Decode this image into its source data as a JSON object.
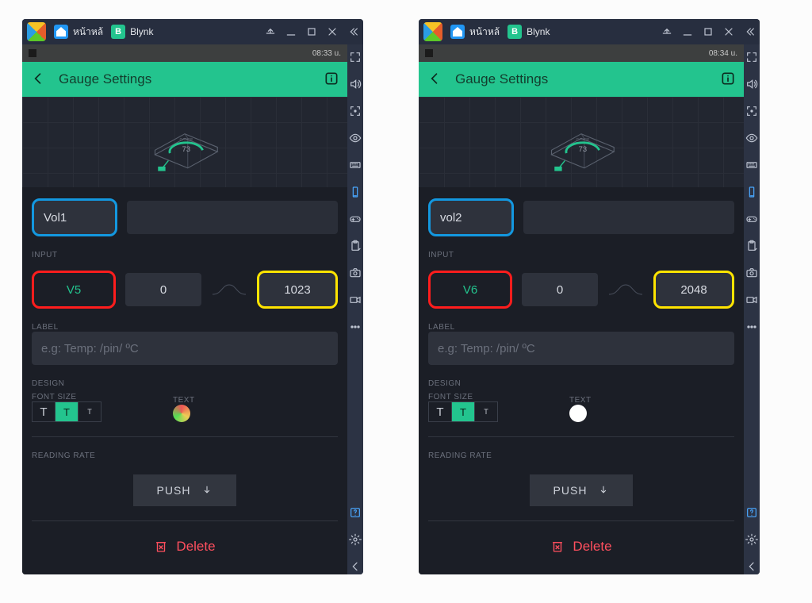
{
  "panels": [
    {
      "tabs": {
        "home": "หน้าหล้",
        "app": "Blynk"
      },
      "status_time": "08:33 u.",
      "header": {
        "title": "Gauge Settings"
      },
      "gauge_preview": {
        "name": "GAUGE",
        "value": "73"
      },
      "name": "Vol1",
      "input": {
        "section": "INPUT",
        "pin": "V5",
        "min": "0",
        "max": "1023"
      },
      "label": {
        "section": "LABEL",
        "placeholder": "e.g: Temp: /pin/ ºC"
      },
      "design": {
        "section": "DESIGN",
        "fontsize": "FONT SIZE",
        "text": "TEXT",
        "color": "gradient"
      },
      "rate": {
        "section": "READING RATE",
        "mode": "PUSH"
      },
      "delete": "Delete"
    },
    {
      "tabs": {
        "home": "หน้าหล้",
        "app": "Blynk"
      },
      "status_time": "08:34 u.",
      "header": {
        "title": "Gauge Settings"
      },
      "gauge_preview": {
        "name": "GAUGE",
        "value": "73"
      },
      "name": "vol2",
      "input": {
        "section": "INPUT",
        "pin": "V6",
        "min": "0",
        "max": "2048"
      },
      "label": {
        "section": "LABEL",
        "placeholder": "e.g: Temp: /pin/ ºC"
      },
      "design": {
        "section": "DESIGN",
        "fontsize": "FONT SIZE",
        "text": "TEXT",
        "color": "white"
      },
      "rate": {
        "section": "READING RATE",
        "mode": "PUSH"
      },
      "delete": "Delete"
    }
  ]
}
